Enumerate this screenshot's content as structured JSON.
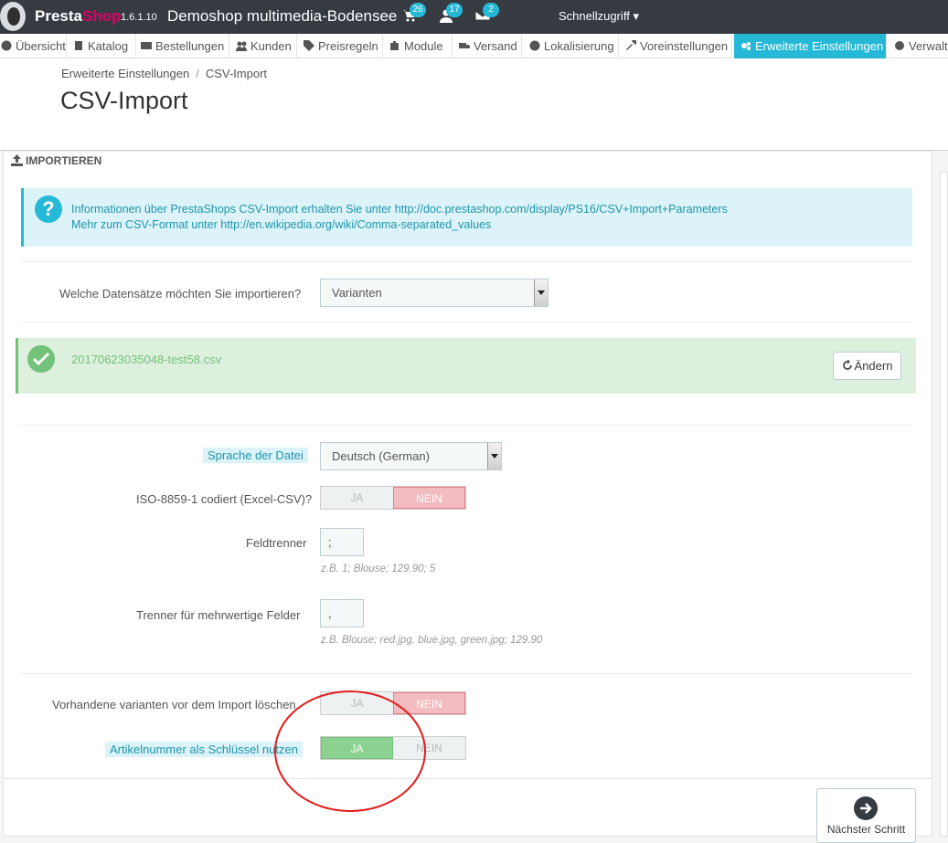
{
  "topbar": {
    "brand_a": "Presta",
    "brand_b": "Shop",
    "version": "1.6.1.10",
    "shop_name": "Demoshop multimedia-Bodensee",
    "badges": {
      "orders": "26",
      "customers": "17",
      "messages": "2"
    },
    "quick_access": "Schnellzugriff"
  },
  "menu": [
    {
      "label": "Übersicht",
      "icon": "dashboard-icon"
    },
    {
      "label": "Katalog",
      "icon": "book-icon"
    },
    {
      "label": "Bestellungen",
      "icon": "credit-card-icon"
    },
    {
      "label": "Kunden",
      "icon": "users-icon"
    },
    {
      "label": "Preisregeln",
      "icon": "tags-icon"
    },
    {
      "label": "Module",
      "icon": "puzzle-icon"
    },
    {
      "label": "Versand",
      "icon": "truck-icon"
    },
    {
      "label": "Lokalisierung",
      "icon": "globe-icon"
    },
    {
      "label": "Voreinstellungen",
      "icon": "wrench-icon"
    },
    {
      "label": "Erweiterte Einstellungen",
      "icon": "cogs-icon",
      "active": true
    },
    {
      "label": "Verwalt",
      "icon": "cog-icon"
    }
  ],
  "breadcrumb": {
    "parent": "Erweiterte Einstellungen",
    "separator": "/",
    "current": "CSV-Import"
  },
  "page_title": "CSV-Import",
  "panel": {
    "heading": "Importieren",
    "info": {
      "line1_text": "Informationen über PrestaShops CSV-Import erhalten Sie unter",
      "line1_link": "http://doc.prestashop.com/display/PS16/CSV+Import+Parameters",
      "line2_text": "Mehr zum CSV-Format unter",
      "line2_link": "http://en.wikipedia.org/wiki/Comma-separated_values"
    },
    "entity": {
      "label": "Welche Datensätze möchten Sie importieren?",
      "value": "Varianten"
    },
    "file": {
      "name": "20170623035048-test58.csv",
      "change_button": "Ändern"
    },
    "language": {
      "label": "Sprache der Datei",
      "value": "Deutsch (German)"
    },
    "iso": {
      "label": "ISO-8859-1 codiert (Excel-CSV)?",
      "yes": "JA",
      "no": "NEIN",
      "selected": "no"
    },
    "separator": {
      "label": "Feldtrenner",
      "value": ";",
      "help": "z.B. 1; Blouse; 129.90; 5"
    },
    "multi_separator": {
      "label": "Trenner für mehrwertige Felder",
      "value": ",",
      "help": "z.B. Blouse; red.jpg, blue.jpg, green.jpg; 129.90"
    },
    "truncate": {
      "label": "Vorhandene varianten vor dem Import löschen",
      "yes": "JA",
      "no": "NEIN",
      "selected": "no"
    },
    "match_ref": {
      "label": "Artikelnummer als Schlüssel nutzen",
      "yes": "JA",
      "no": "NEIN",
      "selected": "yes"
    },
    "next_button": "Nächster Schritt"
  },
  "colors": {
    "accent": "#25b9d7",
    "success": "#72c279",
    "danger": "#e57e85",
    "annotation": "#e41c1c"
  }
}
